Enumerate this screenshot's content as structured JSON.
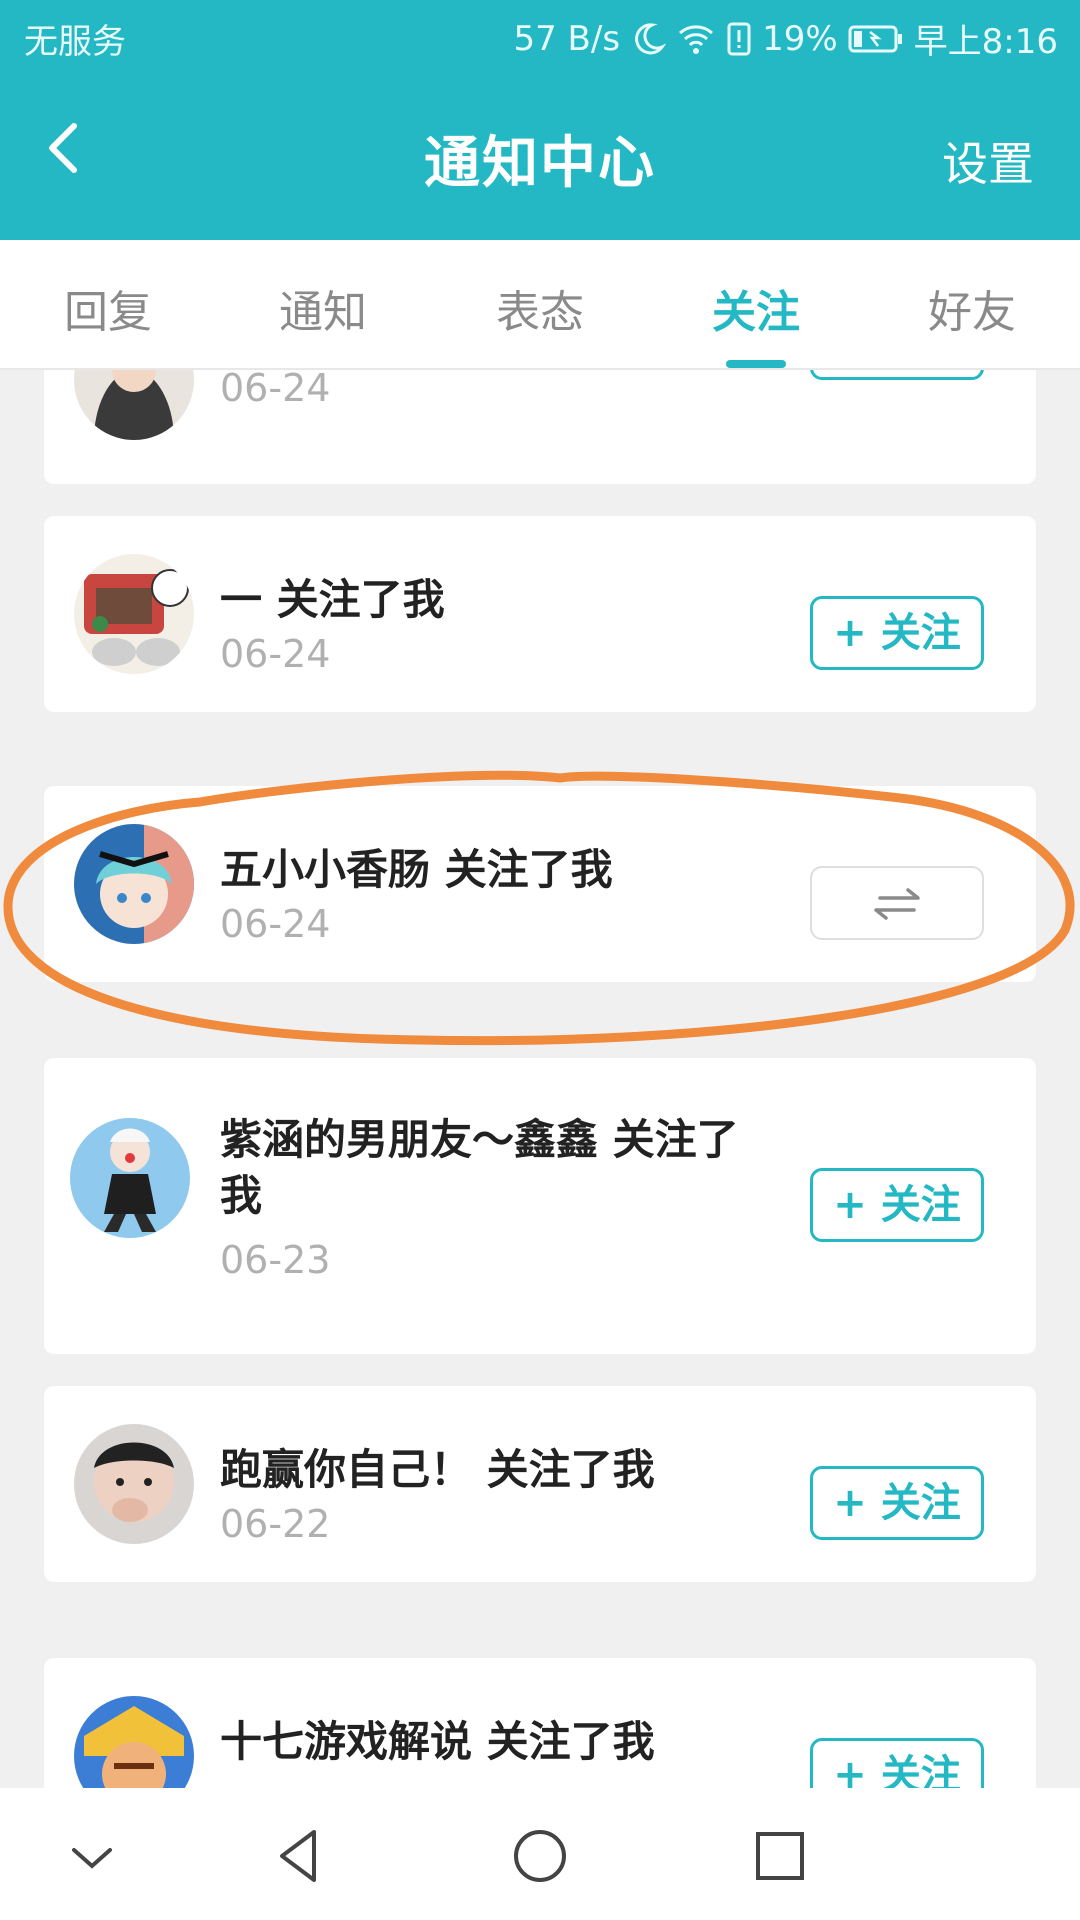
{
  "status_bar": {
    "carrier": "无服务",
    "net_speed": "57 B/s",
    "battery": "19%",
    "time": "早上8:16"
  },
  "header": {
    "title": "通知中心",
    "settings_label": "设置"
  },
  "tabs": [
    {
      "label": "回复"
    },
    {
      "label": "通知"
    },
    {
      "label": "表态"
    },
    {
      "label": "关注",
      "active": true
    },
    {
      "label": "好友"
    }
  ],
  "follow_label": "+ 关注",
  "items": [
    {
      "date": "06-24"
    },
    {
      "name": "一 关注了我",
      "date": "06-24"
    },
    {
      "name": "五小小香肠 关注了我",
      "date": "06-24"
    },
    {
      "name": "紫涵的男朋友～鑫鑫 关注了我",
      "date": "06-23"
    },
    {
      "name": "跑赢你自己！ 关注了我",
      "date": "06-22"
    },
    {
      "name": "十七游戏解说 关注了我"
    }
  ],
  "colors": {
    "accent": "#23b8c3",
    "annotation": "#f08a3c"
  }
}
